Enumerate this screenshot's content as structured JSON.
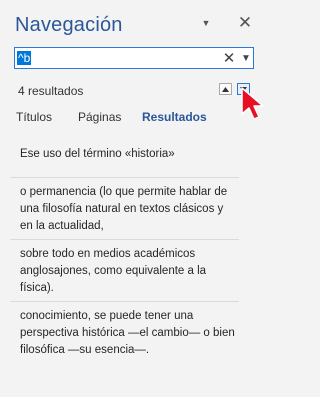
{
  "pane": {
    "title": "Navegación",
    "dropdown_icon": "▼",
    "close_icon": "✕"
  },
  "search": {
    "value": "^b",
    "clear_icon": "✕",
    "dropdown_icon": "▼"
  },
  "results_count": "4 resultados",
  "tabs": [
    {
      "label": "Títulos"
    },
    {
      "label": "Páginas"
    },
    {
      "label": "Resultados",
      "active": true
    }
  ],
  "results": [
    {
      "text": "Ese uso del término «historia»"
    },
    {
      "text": "o permanencia (lo que permite hablar de una filosofía natural en textos clásicos y en la actualidad,"
    },
    {
      "text": "sobre todo en medios académicos anglosajones, como equivalente a la física)."
    },
    {
      "text": "conocimiento, se puede tener una perspectiva histórica —el cambio— o bien filosófica —su esencia—."
    }
  ],
  "colors": {
    "accent": "#2b579a",
    "selection": "#0078d7",
    "cursor": "#e81123"
  }
}
